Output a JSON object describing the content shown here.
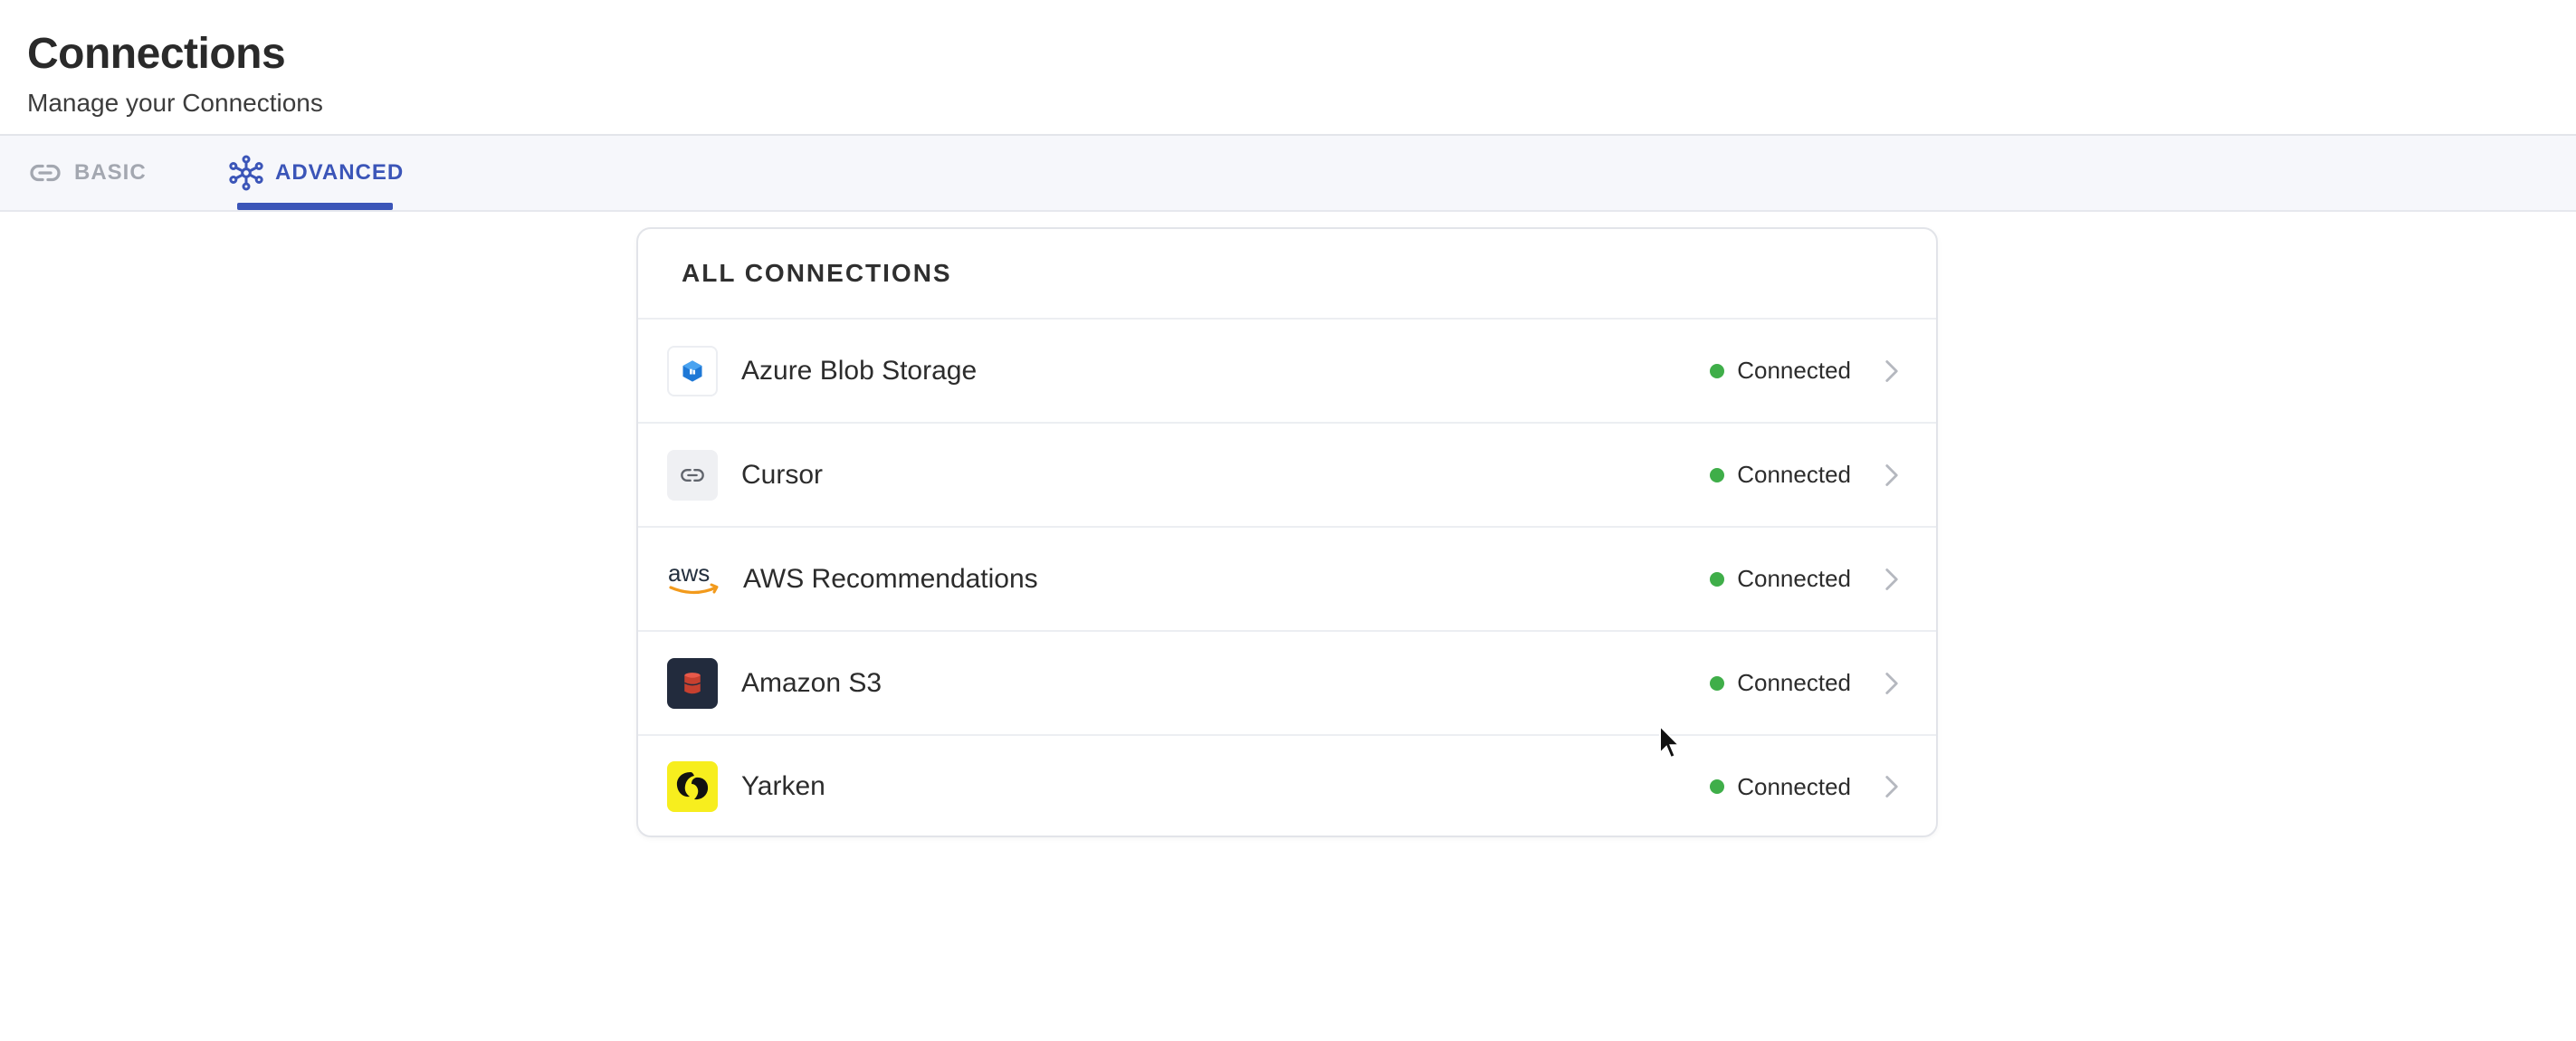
{
  "page": {
    "title": "Connections",
    "subtitle": "Manage your Connections"
  },
  "tabs": [
    {
      "label": "BASIC",
      "icon": "link-icon",
      "active": false
    },
    {
      "label": "ADVANCED",
      "icon": "network-nodes-icon",
      "active": true
    }
  ],
  "colors": {
    "accent": "#3b55b8",
    "status_connected": "#3fae49",
    "inactive_tab": "#a3a7b0"
  },
  "connections": {
    "title": "ALL CONNECTIONS",
    "items": [
      {
        "name": "Azure Blob Storage",
        "icon": "azure-blob-storage-icon",
        "status": "Connected"
      },
      {
        "name": "Cursor",
        "icon": "link-icon",
        "status": "Connected"
      },
      {
        "name": "AWS Recommendations",
        "icon": "aws-logo-icon",
        "status": "Connected",
        "logo_text": "aws"
      },
      {
        "name": "Amazon S3",
        "icon": "amazon-s3-icon",
        "status": "Connected"
      },
      {
        "name": "Yarken",
        "icon": "yarken-logo-icon",
        "status": "Connected"
      }
    ]
  }
}
